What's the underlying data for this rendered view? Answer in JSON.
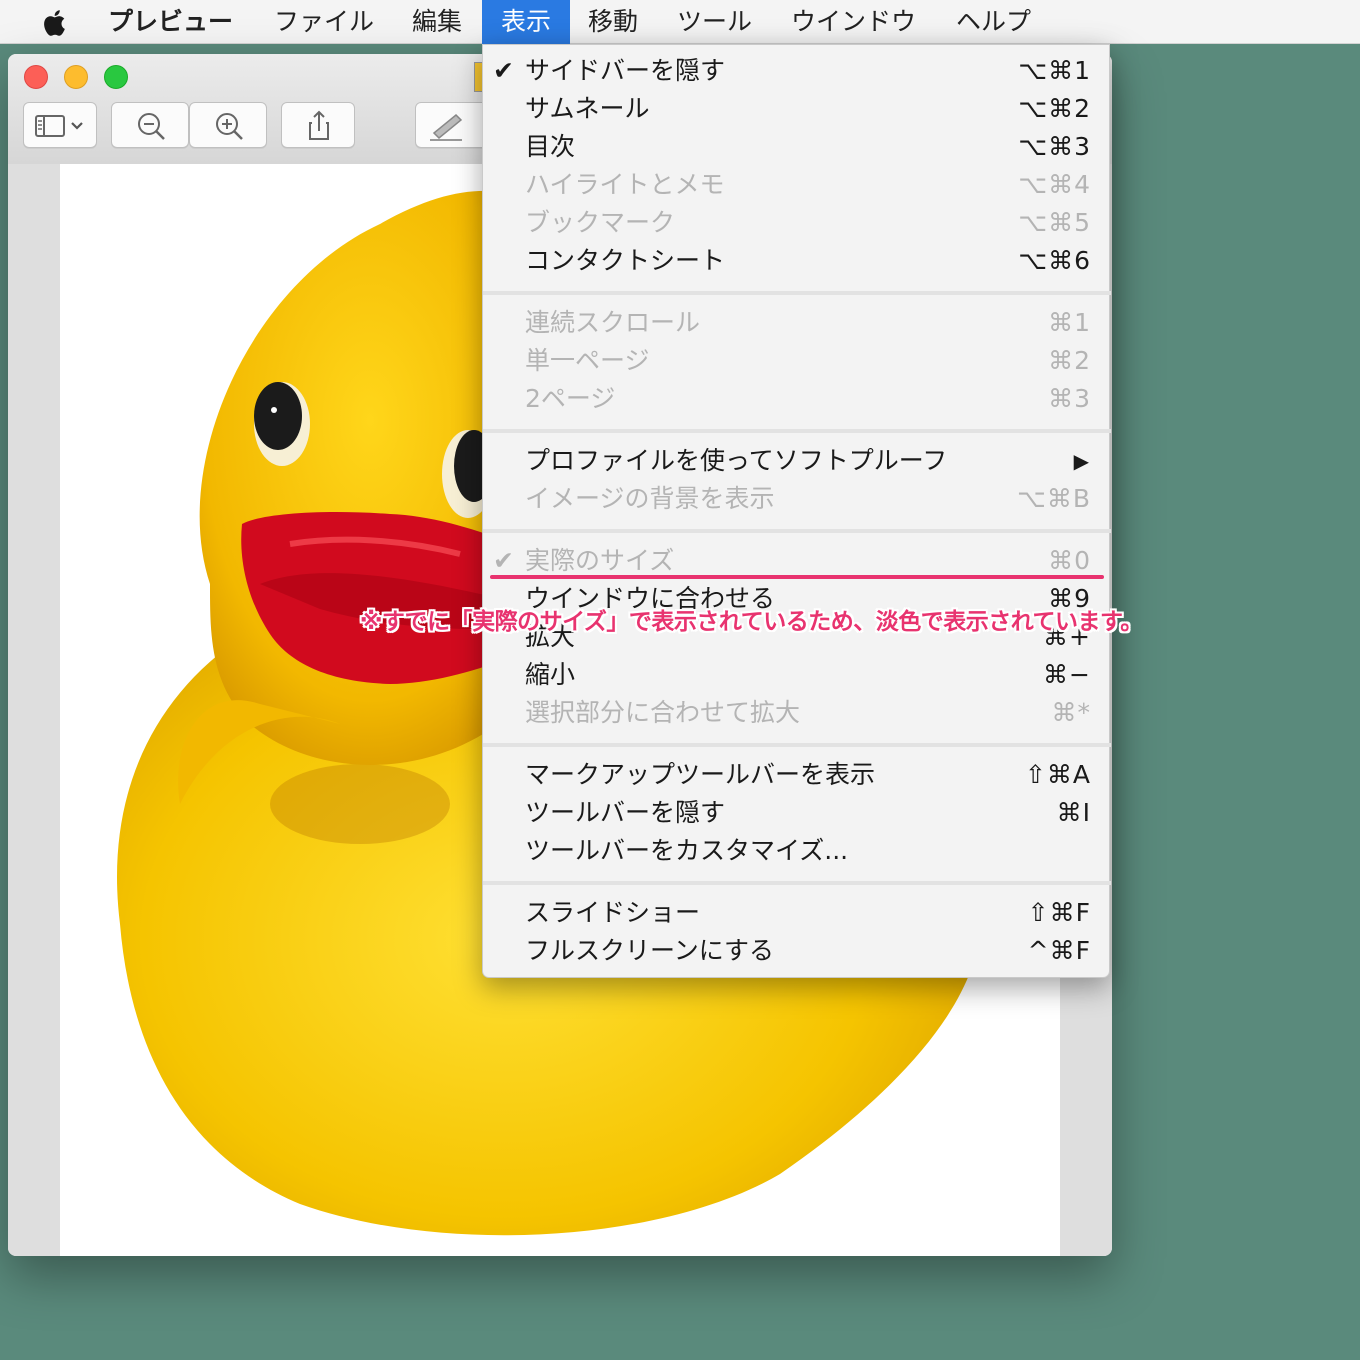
{
  "menubar": {
    "app": "プレビュー",
    "file": "ファイル",
    "edit": "編集",
    "view": "表示",
    "go": "移動",
    "tools": "ツール",
    "window": "ウインドウ",
    "help": "ヘルプ",
    "active_menu_color": "#2a7ae2"
  },
  "toolbar": {
    "icons": [
      "sidebar-icon",
      "chevron-down-icon",
      "zoom-out-icon",
      "zoom-in-icon",
      "share-icon",
      "markup-pen-icon"
    ]
  },
  "view_menu": {
    "items": [
      {
        "label": "サイドバーを隠す",
        "shortcut": "⌥⌘1",
        "checked": true,
        "enabled": true
      },
      {
        "label": "サムネール",
        "shortcut": "⌥⌘2",
        "enabled": true
      },
      {
        "label": "目次",
        "shortcut": "⌥⌘3",
        "enabled": true
      },
      {
        "label": "ハイライトとメモ",
        "shortcut": "⌥⌘4",
        "enabled": false
      },
      {
        "label": "ブックマーク",
        "shortcut": "⌥⌘5",
        "enabled": false
      },
      {
        "label": "コンタクトシート",
        "shortcut": "⌥⌘6",
        "enabled": true
      },
      {
        "label": "連続スクロール",
        "shortcut": "⌘1",
        "enabled": false
      },
      {
        "label": "単一ページ",
        "shortcut": "⌘2",
        "enabled": false
      },
      {
        "label": "2ページ",
        "shortcut": "⌘3",
        "enabled": false
      },
      {
        "label": "プロファイルを使ってソフトプルーフ",
        "shortcut": "▶",
        "enabled": true,
        "submenu": true
      },
      {
        "label": "イメージの背景を表示",
        "shortcut": "⌥⌘B",
        "enabled": false
      },
      {
        "label": "実際のサイズ",
        "shortcut": "⌘0",
        "checked": true,
        "enabled": false
      },
      {
        "label": "ウインドウに合わせる",
        "shortcut": "⌘9",
        "enabled": true
      },
      {
        "label": "拡大",
        "shortcut": "⌘+",
        "enabled": true
      },
      {
        "label": "縮小",
        "shortcut": "⌘−",
        "enabled": true
      },
      {
        "label": "選択部分に合わせて拡大",
        "shortcut": "⌘*",
        "enabled": false
      },
      {
        "label": "マークアップツールバーを表示",
        "shortcut": "⇧⌘A",
        "enabled": true
      },
      {
        "label": "ツールバーを隠す",
        "shortcut": "⌘I",
        "enabled": true
      },
      {
        "label": "ツールバーをカスタマイズ...",
        "shortcut": "",
        "enabled": true
      },
      {
        "label": "スライドショー",
        "shortcut": "⇧⌘F",
        "enabled": true
      },
      {
        "label": "フルスクリーンにする",
        "shortcut": "^⌘F",
        "enabled": true
      }
    ]
  },
  "annotation": {
    "text": "※すでに「実際のサイズ」で表示されているため、淡色で表示されています。",
    "color": "#e8336f"
  },
  "colors": {
    "desktop": "#5a8a7c",
    "duck_yellow": "#f5c800",
    "duck_beak": "#d10a1e"
  }
}
